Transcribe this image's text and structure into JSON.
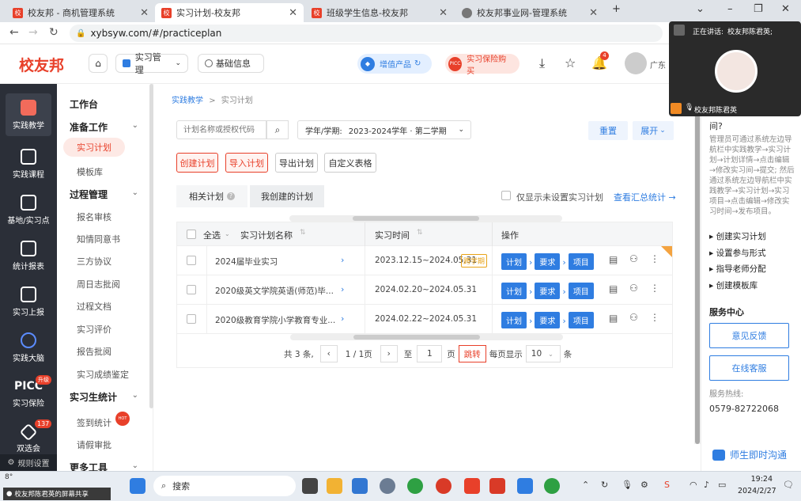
{
  "browser": {
    "tabs": [
      {
        "title": "校友邦 - 商机管理系统",
        "fav": "校"
      },
      {
        "title": "实习计划-校友邦",
        "fav": "校"
      },
      {
        "title": "班级学生信息-校友邦",
        "fav": "校"
      },
      {
        "title": "校友邦事业网-管理系统",
        "fav": ""
      }
    ],
    "url": "xybsyw.com/#/practiceplan"
  },
  "header": {
    "logo": "校友邦",
    "menu_label": "实习管理",
    "basic_info": "基础信息",
    "value_products": "增值产品",
    "insurance": "实习保险购买",
    "picc": "PICC",
    "bell_badge": "4",
    "user_short": "广东"
  },
  "sidebar_dark": [
    {
      "label": "实践教学",
      "icon": "practice-teaching-icon"
    },
    {
      "label": "实践课程",
      "icon": "practice-course-icon"
    },
    {
      "label": "基地/实习点",
      "icon": "base-icon"
    },
    {
      "label": "统计报表",
      "icon": "report-icon"
    },
    {
      "label": "实习上报",
      "icon": "upload-icon"
    },
    {
      "label": "实践大脑",
      "icon": "brain-icon"
    },
    {
      "label": "实习保险",
      "icon": "picc-icon",
      "logo": "PICC",
      "badge": "升级"
    },
    {
      "label": "双选会",
      "icon": "fair-icon",
      "badge": "137"
    }
  ],
  "sidebar_bottom": "规则设置",
  "sidebar_light": {
    "workbench": "工作台",
    "groups": [
      {
        "title": "准备工作",
        "items": [
          "实习计划",
          "模板库"
        ]
      },
      {
        "title": "过程管理",
        "items": [
          "报名审核",
          "知情同意书",
          "三方协议",
          "周日志批阅",
          "过程文档",
          "实习评价",
          "报告批阅",
          "实习成绩鉴定"
        ]
      },
      {
        "title": "实习生统计",
        "items": [
          "签到统计",
          "请假审批"
        ]
      },
      {
        "title": "更多工具",
        "items": []
      }
    ],
    "hot": "HOT"
  },
  "main": {
    "breadcrumb": [
      "实践教学",
      ">",
      "实习计划"
    ],
    "search_placeholder": "计划名称或授权代码",
    "term_label": "学年/学期:",
    "term_value": "2023-2024学年 · 第二学期",
    "reset": "重置",
    "expand": "展开",
    "actions": [
      "创建计划",
      "导入计划",
      "导出计划",
      "自定义表格"
    ],
    "tabs": [
      "相关计划",
      "我创建的计划"
    ],
    "only_unset": "仅显示未设置实习计划",
    "view_summary": "查看汇总统计 →",
    "columns": [
      "全选",
      "实习计划名称",
      "实习时间",
      "操作"
    ],
    "rows": [
      {
        "name": "2024届毕业实习",
        "time": "2023.12.15~2024.05.31",
        "cross": "跨学期"
      },
      {
        "name": "2020级英文学院英语(师范)毕...",
        "time": "2024.02.20~2024.05.31",
        "cross": ""
      },
      {
        "name": "2020级教育学院小学教育专业...",
        "time": "2024.02.22~2024.05.31",
        "cross": ""
      }
    ],
    "row_tags": [
      "计划",
      "要求",
      "项目"
    ],
    "pager": {
      "total": "共 3 条,",
      "page": "1 / 1页",
      "goto": "至",
      "page_input": "1",
      "page_unit": "页",
      "jump": "跳转",
      "per_page": "每页显示",
      "size": "10",
      "unit": "条"
    }
  },
  "right_panel": {
    "question": "间?",
    "help": "管理员可通过系统左边导航栏中实践教学→实习计划→计划详情→点击编辑→修改实习间→提交; 然后通过系统左边导航栏中实践教学→实习计划→实习项目→点击编辑→修改实习时间→发布项目。",
    "links": [
      "创建实习计划",
      "设置参与形式",
      "指导老师分配",
      "创建模板库"
    ],
    "service": "服务中心",
    "feedback": "意见反馈",
    "online": "在线客服",
    "hotline_label": "服务热线:",
    "hotline": "0579-82722068",
    "chat": "师生即时沟通"
  },
  "video": {
    "speaking": "正在讲话:",
    "speaker": "校友邦陈君英;",
    "name": "校友邦陈君英"
  },
  "taskbar": {
    "temp": "8°",
    "share": "校友邦陈君英的屏幕共享",
    "search": "搜索",
    "time": "19:24",
    "date": "2024/2/27"
  }
}
